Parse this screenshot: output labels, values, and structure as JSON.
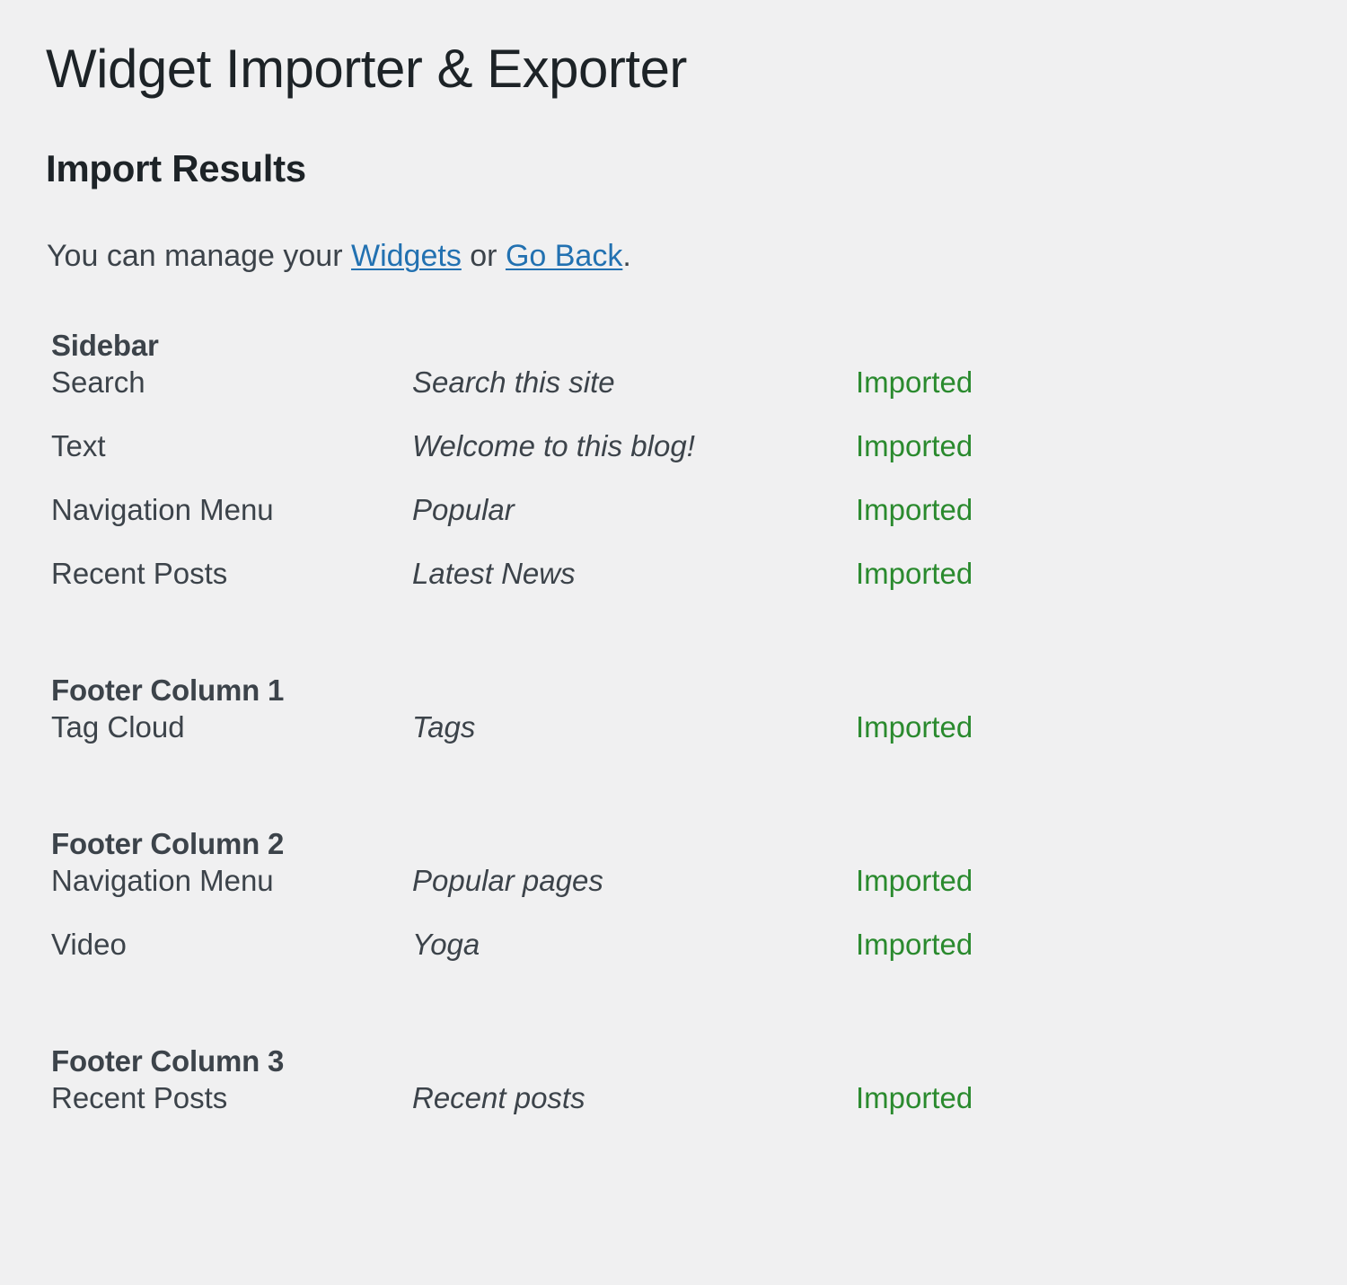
{
  "page": {
    "title": "Widget Importer & Exporter",
    "section_heading": "Import Results"
  },
  "intro": {
    "before_links": "You can manage your ",
    "widgets_link": "Widgets",
    "between_links": " or ",
    "go_back_link": "Go Back",
    "after_links": "."
  },
  "colors": {
    "background": "#f0f0f1",
    "heading": "#1d2327",
    "body_text": "#3c434a",
    "link": "#2271b1",
    "status_success": "#2a8a2e"
  },
  "results": {
    "groups": [
      {
        "name": "Sidebar",
        "widgets": [
          {
            "type": "Search",
            "title": "Search this site",
            "status": "Imported"
          },
          {
            "type": "Text",
            "title": "Welcome to this blog!",
            "status": "Imported"
          },
          {
            "type": "Navigation Menu",
            "title": "Popular",
            "status": "Imported"
          },
          {
            "type": "Recent Posts",
            "title": "Latest News",
            "status": "Imported"
          }
        ]
      },
      {
        "name": "Footer Column 1",
        "widgets": [
          {
            "type": "Tag Cloud",
            "title": "Tags",
            "status": "Imported"
          }
        ]
      },
      {
        "name": "Footer Column 2",
        "widgets": [
          {
            "type": "Navigation Menu",
            "title": "Popular pages",
            "status": "Imported"
          },
          {
            "type": "Video",
            "title": "Yoga",
            "status": "Imported"
          }
        ]
      },
      {
        "name": "Footer Column 3",
        "widgets": [
          {
            "type": "Recent Posts",
            "title": "Recent posts",
            "status": "Imported"
          }
        ]
      }
    ]
  }
}
